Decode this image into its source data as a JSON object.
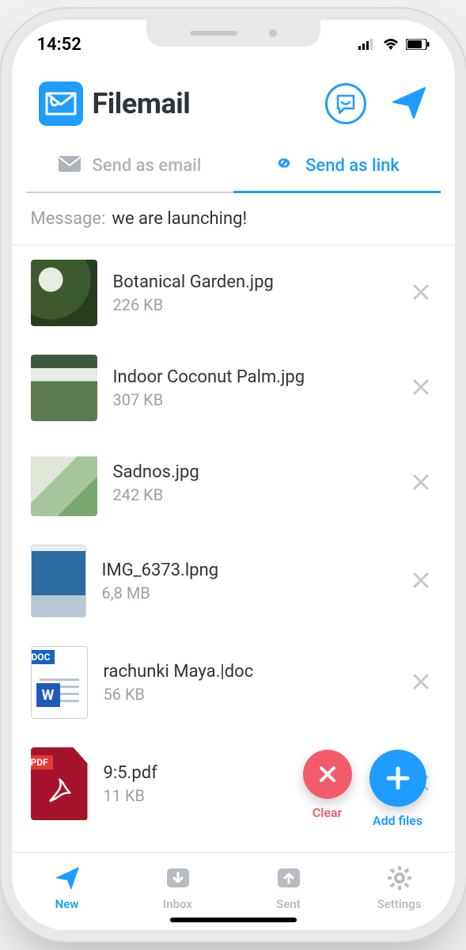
{
  "status": {
    "time": "14:52"
  },
  "brand": {
    "name": "Filemail"
  },
  "tabs": {
    "email": "Send as email",
    "link": "Send as link"
  },
  "message": {
    "label": "Message:",
    "text": "we are launching!"
  },
  "files": [
    {
      "name": "Botanical Garden.jpg",
      "size": "226 KB"
    },
    {
      "name": "Indoor Coconut Palm.jpg",
      "size": "307 KB"
    },
    {
      "name": "Sadnos.jpg",
      "size": "242 KB"
    },
    {
      "name": "IMG_6373.lpng",
      "size": "6,8 MB"
    },
    {
      "name": "rachunki Maya.|doc",
      "size": "56 KB"
    },
    {
      "name": "9:5.pdf",
      "size": "11 KB"
    }
  ],
  "fab": {
    "clear": "Clear",
    "add": "Add files"
  },
  "bottom": {
    "new": "New",
    "inbox": "Inbox",
    "sent": "Sent",
    "settings": "Settings"
  },
  "doc_badge": "DOC",
  "pdf_badge": "PDF"
}
